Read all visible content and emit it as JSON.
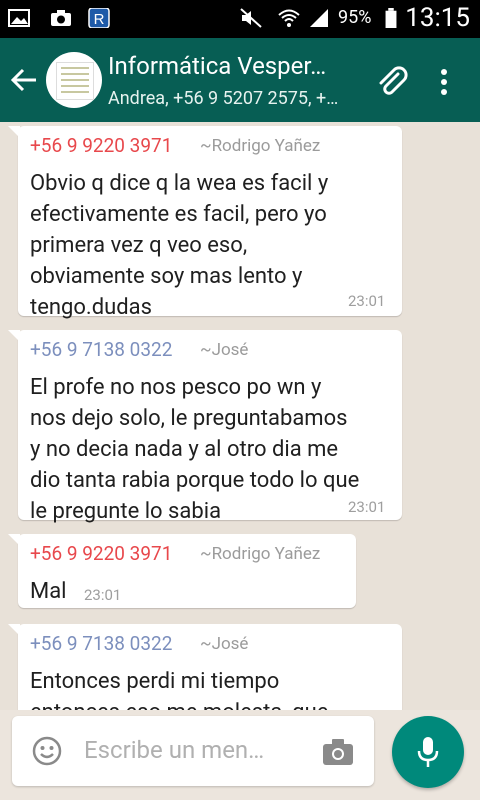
{
  "status_bar": {
    "battery": "95%",
    "time": "13:15",
    "icons": [
      "image-icon",
      "camera-icon",
      "r-app-icon",
      "mute-icon",
      "wifi-icon",
      "signal-icon",
      "battery-icon"
    ]
  },
  "header": {
    "title": "Informática Vesper…",
    "subtitle": "Andrea, +56 9 5207 2575, +…",
    "back_icon": "arrow-back-icon",
    "attach_icon": "paperclip-icon",
    "menu_icon": "more-vert-icon"
  },
  "messages": [
    {
      "sender": "+56 9 9220 3971",
      "alias": "~Rodrigo Yañez",
      "color": "#e8484c",
      "lines": [
        "Obvio q dice q la wea es facil y",
        "efectivamente es facil, pero yo",
        "primera vez q veo eso,",
        "obviamente soy mas lento y",
        "tengo.dudas"
      ],
      "time": "23:01"
    },
    {
      "sender": "+56 9 7138 0322",
      "alias": "~José",
      "color": "#7c8fbd",
      "lines": [
        "El profe no nos pesco po wn y",
        "nos dejo solo, le preguntabamos",
        "y no decia nada y al otro dia me",
        "dio tanta rabia porque todo lo que",
        "le pregunte lo sabia"
      ],
      "time": "23:01"
    },
    {
      "sender": "+56 9 9220 3971",
      "alias": "~Rodrigo Yañez",
      "color": "#e8484c",
      "lines": [
        "Mal"
      ],
      "time": "23:01"
    },
    {
      "sender": "+56 9 7138 0322",
      "alias": "~José",
      "color": "#7c8fbd",
      "lines": [
        "Entonces perdi mi tiempo",
        "entonces eso me molesta, que"
      ],
      "time": ""
    }
  ],
  "input": {
    "placeholder": "Escribe un men…"
  },
  "colors": {
    "app_bar": "#075e54",
    "fab": "#00897b",
    "chat_bg": "#e8e1d8"
  }
}
